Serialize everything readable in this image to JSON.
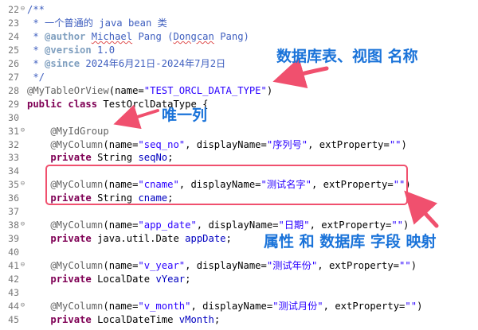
{
  "editor": {
    "lines": [
      {
        "num": "22",
        "fold": "⊖",
        "tokens": [
          {
            "t": "/**",
            "c": "com"
          }
        ]
      },
      {
        "num": "23",
        "fold": "",
        "tokens": [
          {
            "t": " * 一个普通的 java bean 类",
            "c": "com"
          }
        ]
      },
      {
        "num": "24",
        "fold": "",
        "tokens": [
          {
            "t": " * ",
            "c": "com"
          },
          {
            "t": "@author",
            "c": "tag"
          },
          {
            "t": " ",
            "c": "com"
          },
          {
            "t": "Michael",
            "c": "com",
            "squiggle": true
          },
          {
            "t": " Pang (",
            "c": "com"
          },
          {
            "t": "Dongcan",
            "c": "com",
            "squiggle": true
          },
          {
            "t": " Pang)",
            "c": "com"
          }
        ]
      },
      {
        "num": "25",
        "fold": "",
        "tokens": [
          {
            "t": " * ",
            "c": "com"
          },
          {
            "t": "@version",
            "c": "tag"
          },
          {
            "t": " 1.0",
            "c": "com"
          }
        ]
      },
      {
        "num": "26",
        "fold": "",
        "tokens": [
          {
            "t": " * ",
            "c": "com"
          },
          {
            "t": "@since",
            "c": "tag"
          },
          {
            "t": " 2024年6月21日-2024年7月2日",
            "c": "com"
          }
        ]
      },
      {
        "num": "27",
        "fold": "",
        "tokens": [
          {
            "t": " */",
            "c": "com"
          }
        ]
      },
      {
        "num": "28",
        "fold": "",
        "tokens": [
          {
            "t": "@MyTableOrView",
            "c": "ann"
          },
          {
            "t": "(name=",
            "c": "plain"
          },
          {
            "t": "\"TEST_ORCL_DATA_TYPE\"",
            "c": "str"
          },
          {
            "t": ")",
            "c": "plain"
          }
        ]
      },
      {
        "num": "29",
        "fold": "",
        "tokens": [
          {
            "t": "public",
            "c": "kw"
          },
          {
            "t": " ",
            "c": "plain"
          },
          {
            "t": "class",
            "c": "kw"
          },
          {
            "t": " TestOrclDataType {",
            "c": "plain"
          }
        ]
      },
      {
        "num": "30",
        "fold": "",
        "tokens": []
      },
      {
        "num": "31",
        "fold": "⊖",
        "tokens": [
          {
            "t": "    @MyIdGroup",
            "c": "ann"
          }
        ]
      },
      {
        "num": "32",
        "fold": "",
        "tokens": [
          {
            "t": "    @MyColumn",
            "c": "ann"
          },
          {
            "t": "(name=",
            "c": "plain"
          },
          {
            "t": "\"seq_no\"",
            "c": "str"
          },
          {
            "t": ", displayName=",
            "c": "plain"
          },
          {
            "t": "\"序列号\"",
            "c": "str"
          },
          {
            "t": ", extProperty=",
            "c": "plain"
          },
          {
            "t": "\"\"",
            "c": "str"
          },
          {
            "t": ")",
            "c": "plain"
          }
        ]
      },
      {
        "num": "33",
        "fold": "",
        "tokens": [
          {
            "t": "    ",
            "c": "plain"
          },
          {
            "t": "private",
            "c": "kw"
          },
          {
            "t": " String ",
            "c": "plain"
          },
          {
            "t": "seqNo",
            "c": "fld"
          },
          {
            "t": ";",
            "c": "plain"
          }
        ]
      },
      {
        "num": "34",
        "fold": "",
        "tokens": []
      },
      {
        "num": "35",
        "fold": "⊖",
        "tokens": [
          {
            "t": "    @MyColumn",
            "c": "ann"
          },
          {
            "t": "(name=",
            "c": "plain"
          },
          {
            "t": "\"cname\"",
            "c": "str"
          },
          {
            "t": ", displayName=",
            "c": "plain"
          },
          {
            "t": "\"测试名字\"",
            "c": "str"
          },
          {
            "t": ", extProperty=",
            "c": "plain"
          },
          {
            "t": "\"\"",
            "c": "str"
          },
          {
            "t": ")",
            "c": "plain"
          }
        ]
      },
      {
        "num": "36",
        "fold": "",
        "tokens": [
          {
            "t": "    ",
            "c": "plain"
          },
          {
            "t": "private",
            "c": "kw"
          },
          {
            "t": " String ",
            "c": "plain"
          },
          {
            "t": "cname",
            "c": "fld"
          },
          {
            "t": ";",
            "c": "plain"
          }
        ]
      },
      {
        "num": "37",
        "fold": "",
        "tokens": []
      },
      {
        "num": "38",
        "fold": "⊖",
        "tokens": [
          {
            "t": "    @MyColumn",
            "c": "ann"
          },
          {
            "t": "(name=",
            "c": "plain"
          },
          {
            "t": "\"app_date\"",
            "c": "str"
          },
          {
            "t": ", displayName=",
            "c": "plain"
          },
          {
            "t": "\"日期\"",
            "c": "str"
          },
          {
            "t": ", extProperty=",
            "c": "plain"
          },
          {
            "t": "\"\"",
            "c": "str"
          },
          {
            "t": ")",
            "c": "plain"
          }
        ]
      },
      {
        "num": "39",
        "fold": "",
        "tokens": [
          {
            "t": "    ",
            "c": "plain"
          },
          {
            "t": "private",
            "c": "kw"
          },
          {
            "t": " java.util.Date ",
            "c": "plain"
          },
          {
            "t": "appDate",
            "c": "fld"
          },
          {
            "t": ";",
            "c": "plain"
          }
        ]
      },
      {
        "num": "40",
        "fold": "",
        "tokens": []
      },
      {
        "num": "41",
        "fold": "⊖",
        "tokens": [
          {
            "t": "    @MyColumn",
            "c": "ann"
          },
          {
            "t": "(name=",
            "c": "plain"
          },
          {
            "t": "\"v_year\"",
            "c": "str"
          },
          {
            "t": ", displayName=",
            "c": "plain"
          },
          {
            "t": "\"测试年份\"",
            "c": "str"
          },
          {
            "t": ", extProperty=",
            "c": "plain"
          },
          {
            "t": "\"\"",
            "c": "str"
          },
          {
            "t": ")",
            "c": "plain"
          }
        ]
      },
      {
        "num": "42",
        "fold": "",
        "tokens": [
          {
            "t": "    ",
            "c": "plain"
          },
          {
            "t": "private",
            "c": "kw"
          },
          {
            "t": " LocalDate ",
            "c": "plain"
          },
          {
            "t": "vYear",
            "c": "fld"
          },
          {
            "t": ";",
            "c": "plain"
          }
        ]
      },
      {
        "num": "43",
        "fold": "",
        "tokens": []
      },
      {
        "num": "44",
        "fold": "⊖",
        "tokens": [
          {
            "t": "    @MyColumn",
            "c": "ann"
          },
          {
            "t": "(name=",
            "c": "plain"
          },
          {
            "t": "\"v_month\"",
            "c": "str"
          },
          {
            "t": ", displayName=",
            "c": "plain"
          },
          {
            "t": "\"测试月份\"",
            "c": "str"
          },
          {
            "t": ", extProperty=",
            "c": "plain"
          },
          {
            "t": "\"\"",
            "c": "str"
          },
          {
            "t": ")",
            "c": "plain"
          }
        ]
      },
      {
        "num": "45",
        "fold": "",
        "tokens": [
          {
            "t": "    ",
            "c": "plain"
          },
          {
            "t": "private",
            "c": "kw"
          },
          {
            "t": " LocalDateTime ",
            "c": "plain"
          },
          {
            "t": "vMonth",
            "c": "fld"
          },
          {
            "t": ";",
            "c": "plain"
          }
        ]
      }
    ]
  },
  "annotations": {
    "table_view_name": "数据库表、视图 名称",
    "unique_column": "唯一列",
    "field_mapping": "属性 和 数据库 字段 映射"
  },
  "colors": {
    "comment": "#3f5fbf",
    "javadoc_tag": "#7f9fbf",
    "annotation": "#646464",
    "keyword": "#7f0055",
    "string": "#2a00ff",
    "field": "#0000c0",
    "callout_text": "#1a73d9",
    "highlight_box": "#f0506e"
  }
}
